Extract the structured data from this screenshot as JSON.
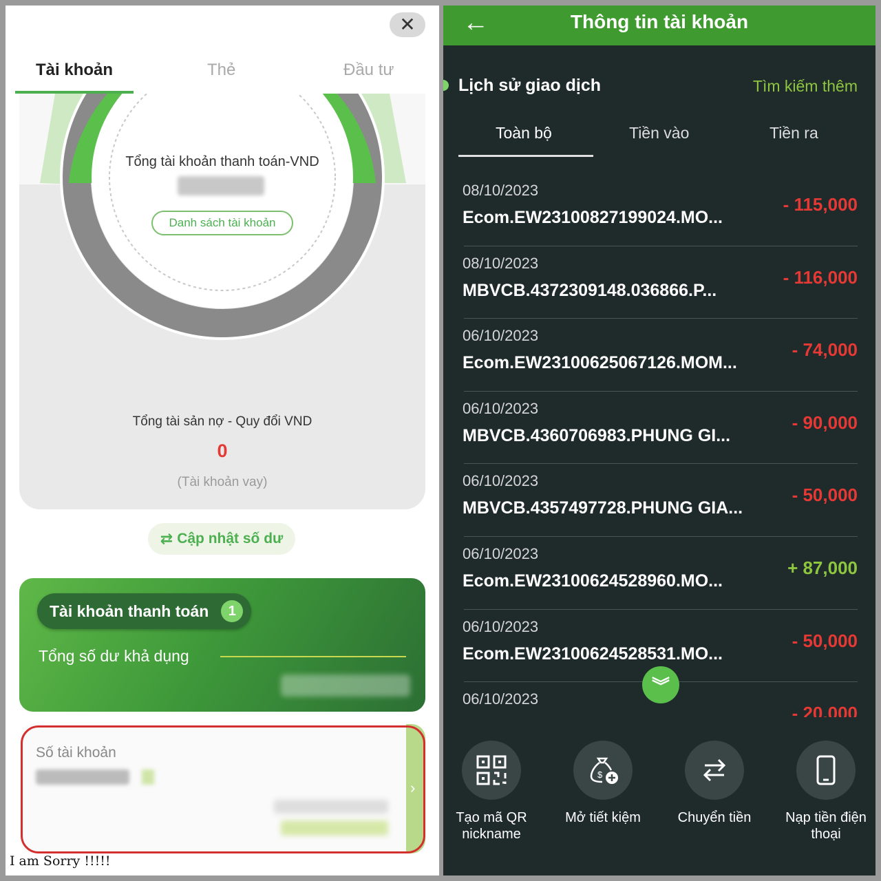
{
  "left": {
    "close_label": "✕",
    "tabs": [
      "Tài khoản",
      "Thẻ",
      "Đầu tư"
    ],
    "total_title": "Tổng tài khoản thanh toán-VND",
    "account_list_button": "Danh sách tài khoản",
    "debt_title": "Tổng tài sản nợ - Quy đổi VND",
    "debt_value": "0",
    "debt_note": "(Tài khoản vay)",
    "update_balance": "Cập nhật số dư",
    "payment_account": "Tài khoản thanh toán",
    "payment_account_count": "1",
    "available_balance": "Tổng số dư khả dụng",
    "account_number_label": "Số tài khoản",
    "caption": "I am Sorry !!!!!"
  },
  "right": {
    "header_title": "Thông tin tài khoản",
    "history_title": "Lịch sử giao dịch",
    "search_more": "Tìm kiếm thêm",
    "tabs": [
      "Toàn bộ",
      "Tiền vào",
      "Tiền ra"
    ],
    "transactions": [
      {
        "date": "08/10/2023",
        "desc": "Ecom.EW23100827199024.MO...",
        "amount": "- 115,000",
        "type": "neg"
      },
      {
        "date": "08/10/2023",
        "desc": "MBVCB.4372309148.036866.P...",
        "amount": "- 116,000",
        "type": "neg"
      },
      {
        "date": "06/10/2023",
        "desc": "Ecom.EW23100625067126.MOM...",
        "amount": "- 74,000",
        "type": "neg"
      },
      {
        "date": "06/10/2023",
        "desc": "MBVCB.4360706983.PHUNG GI...",
        "amount": "- 90,000",
        "type": "neg"
      },
      {
        "date": "06/10/2023",
        "desc": "MBVCB.4357497728.PHUNG GIA...",
        "amount": "- 50,000",
        "type": "neg"
      },
      {
        "date": "06/10/2023",
        "desc": "Ecom.EW23100624528960.MO...",
        "amount": "+ 87,000",
        "type": "pos"
      },
      {
        "date": "06/10/2023",
        "desc": "Ecom.EW23100624528531.MO...",
        "amount": "- 50,000",
        "type": "neg"
      },
      {
        "date": "06/10/2023",
        "desc": "",
        "amount": "- 20,000",
        "type": "neg"
      }
    ],
    "actions": [
      {
        "label": "Tạo mã QR nickname",
        "icon": "qr-code-icon"
      },
      {
        "label": "Mở tiết kiệm",
        "icon": "savings-bag-icon"
      },
      {
        "label": "Chuyển tiền",
        "icon": "transfer-icon"
      },
      {
        "label": "Nạp tiền điện thoại",
        "icon": "phone-icon"
      }
    ]
  }
}
